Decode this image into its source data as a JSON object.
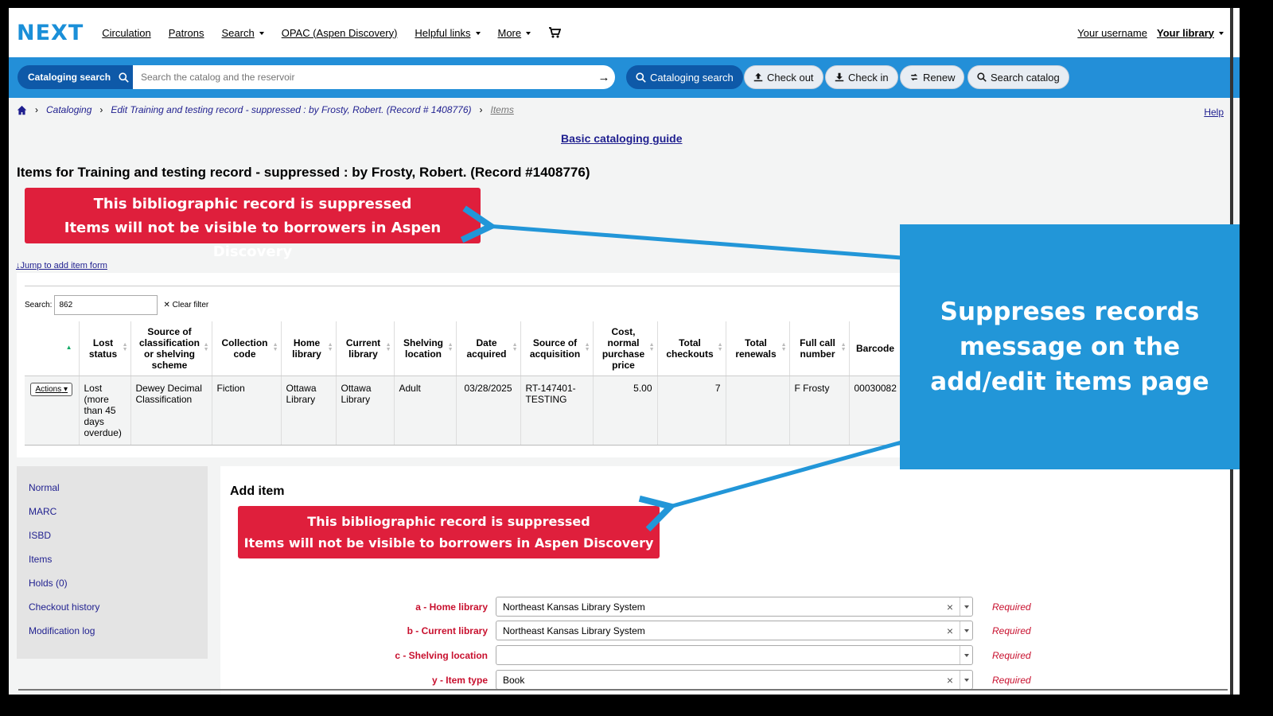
{
  "nav": {
    "logo": "NEXT",
    "links": [
      "Circulation",
      "Patrons",
      "Search",
      "OPAC (Aspen Discovery)",
      "Helpful links",
      "More"
    ],
    "username": "Your username",
    "library": "Your library"
  },
  "searchbar": {
    "scope_label": "Cataloging search",
    "placeholder": "Search the catalog and the reservoir",
    "buttons": [
      "Cataloging search",
      "Check out",
      "Check in",
      "Renew",
      "Search catalog"
    ]
  },
  "breadcrumb": {
    "items": [
      "Cataloging",
      "Edit Training and testing record - suppressed : by Frosty, Robert. (Record # 1408776)",
      "Items"
    ],
    "help": "Help"
  },
  "guide_link": "Basic cataloging guide",
  "page_title": "Items for Training and testing record - suppressed : by Frosty, Robert. (Record #1408776)",
  "alert": {
    "line1": "This bibliographic record is suppressed",
    "line2": "Items will not be visible to borrowers in Aspen Discovery"
  },
  "jump_link": "Jump to add item form",
  "table": {
    "search_label": "Search:",
    "search_value": "862",
    "clear_filter": "Clear filter",
    "headers": [
      "",
      "Lost status",
      "Source of classification or shelving scheme",
      "Collection code",
      "Home library",
      "Current library",
      "Shelving location",
      "Date acquired",
      "Source of acquisition",
      "Cost, normal purchase price",
      "Total checkouts",
      "Total renewals",
      "Full call number",
      "Barcode"
    ],
    "row": {
      "actions": "Actions",
      "lost": "Lost (more than 45 days overdue)",
      "source": "Dewey Decimal Classification",
      "collection": "Fiction",
      "home": "Ottawa Library",
      "current": "Ottawa Library",
      "shelving": "Adult",
      "date": "03/28/2025",
      "acq": "RT-147401-TESTING",
      "cost": "5.00",
      "checkouts": "7",
      "renewals": "",
      "callnum": "F Frosty",
      "barcode": "00030082"
    }
  },
  "sidenav": [
    "Normal",
    "MARC",
    "ISBD",
    "Items",
    "Holds (0)",
    "Checkout history",
    "Modification log"
  ],
  "add_item": {
    "title": "Add item",
    "fields": [
      {
        "label": "a - Home library",
        "value": "Northeast Kansas Library System",
        "required": "Required"
      },
      {
        "label": "b - Current library",
        "value": "Northeast Kansas Library System",
        "required": "Required"
      },
      {
        "label": "c - Shelving location",
        "value": "",
        "required": "Required"
      },
      {
        "label": "y - Item type",
        "value": "Book",
        "required": "Required"
      }
    ]
  },
  "callout": "Suppreses records message on the add/edit items page",
  "colors": {
    "brand": "#1a8fd8",
    "band": "#238fd8",
    "alert": "#df1f3c",
    "callout": "#2296d8",
    "link": "#1f1f8f"
  }
}
